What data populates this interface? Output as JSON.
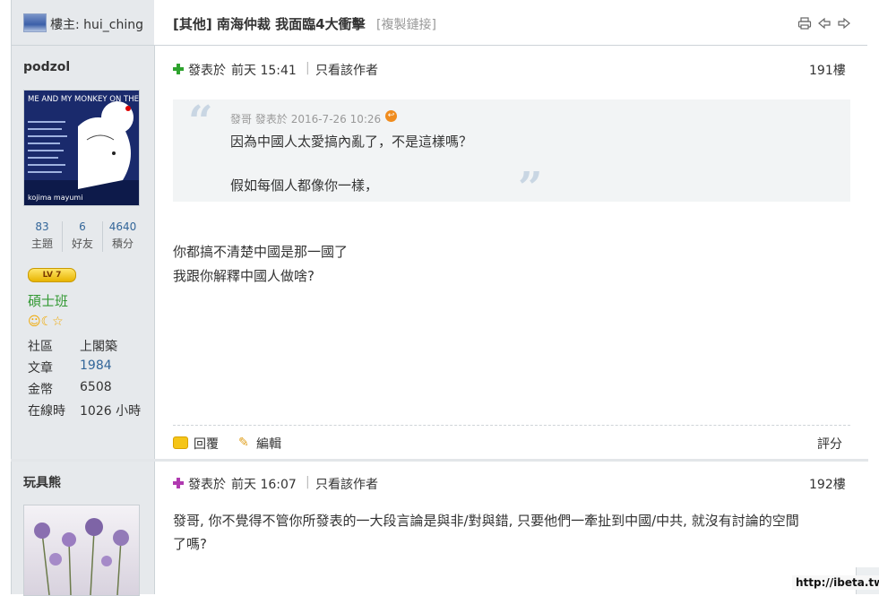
{
  "header": {
    "owner_label": "樓主: hui_ching",
    "thread_title": "[其他] 南海仲裁 我面臨4大衝擊",
    "copy_link": "[複製鏈接]",
    "icons": [
      "print-icon",
      "prev-thread-icon",
      "next-thread-icon"
    ]
  },
  "post1": {
    "author": "podzol",
    "avatar_title": "ME AND MY MONKEY ON THE MOON",
    "avatar_caption": "kojima mayumi",
    "stats": [
      {
        "value": "83",
        "label": "主題"
      },
      {
        "value": "6",
        "label": "好友"
      },
      {
        "value": "4640",
        "label": "積分"
      }
    ],
    "level_badge": "LV 7",
    "rank": "碩士班",
    "medals": [
      "smile-medal-icon",
      "moon-medal-icon",
      "star-medal-icon"
    ],
    "info": [
      {
        "label": "社區",
        "value": "上閣築"
      },
      {
        "label": "文章",
        "value": "1984"
      },
      {
        "label": "金幣",
        "value": "6508"
      },
      {
        "label": "在線時",
        "value": "1026 小時"
      }
    ],
    "posted_prefix": "發表於",
    "posted_time": "前天 15:41",
    "only_author": "只看該作者",
    "floor": "191樓",
    "quote": {
      "author": "發哥",
      "prefix": "發表於",
      "time": "2016-7-26 10:26",
      "lines": [
        "因為中國人太愛搞內亂了，不是這樣嗎？",
        "假如每個人都像你一樣，"
      ]
    },
    "body": [
      "你都搞不清楚中國是那一國了",
      "我跟你解釋中國人做啥?"
    ],
    "actions": {
      "reply": "回覆",
      "edit": "編輯",
      "rate": "評分"
    }
  },
  "post2": {
    "author": "玩具熊",
    "posted_prefix": "發表於",
    "posted_time": "前天 16:07",
    "only_author": "只看該作者",
    "floor": "192樓",
    "body": [
      "發哥, 你不覺得不管你所發表的一大段言論是與非/對與錯, 只要他們一牽扯到中國/中共, 就沒有討論的空間",
      "了嗎?"
    ]
  },
  "watermark": "http://ibeta.tw",
  "colors": {
    "author_bg": "#e6e9ec",
    "link": "#336699",
    "rank": "#339933",
    "quote_bg": "#f2f4f5"
  }
}
